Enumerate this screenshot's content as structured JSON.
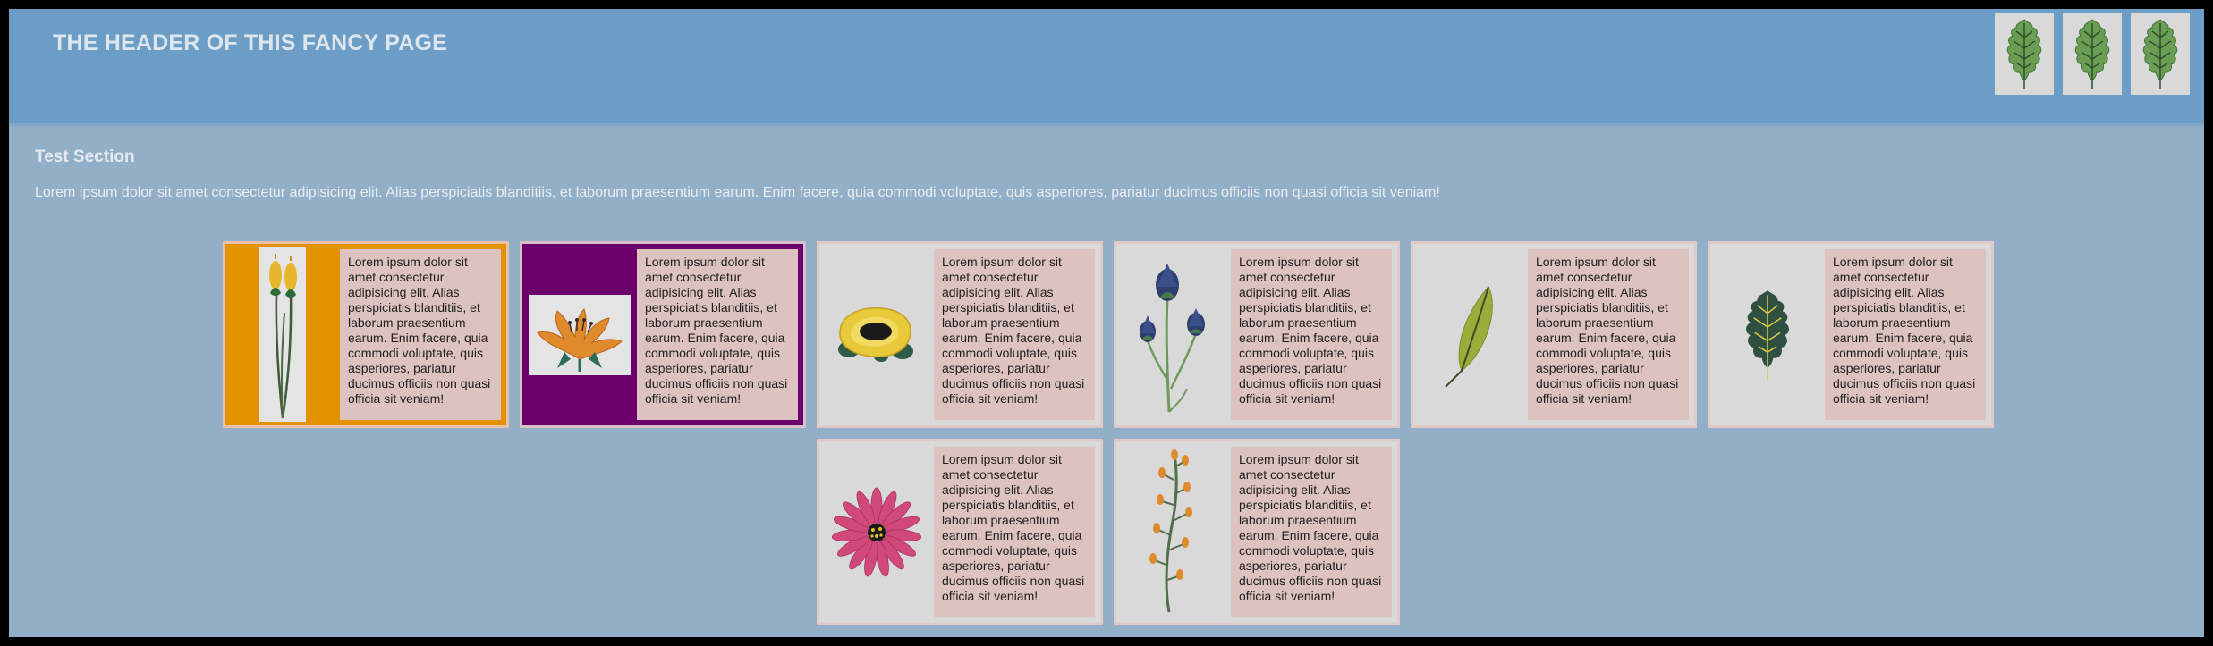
{
  "header": {
    "title": "THE HEADER OF THIS FANCY PAGE",
    "icons": [
      "oak-leaf-icon",
      "oak-leaf-icon",
      "oak-leaf-icon"
    ]
  },
  "section": {
    "title": "Test Section",
    "intro": "Lorem ipsum dolor sit amet consectetur adipisicing elit. Alias perspiciatis blanditiis, et laborum praesentium earum. Enim facere, quia commodi voluptate, quis asperiores, pariatur ducimus officiis non quasi officia sit veniam!"
  },
  "cards": [
    {
      "image": "yellow-tulip-buds-illustration",
      "text": "Lorem ipsum dolor sit amet consectetur adipisicing elit. Alias perspiciatis blanditiis, et laborum praesentium earum. Enim facere, quia commodi voluptate, quis asperiores, pariatur ducimus officiis non quasi officia sit veniam!",
      "background": "#e39300"
    },
    {
      "image": "orange-flower-illustration",
      "text": "Lorem ipsum dolor sit amet consectetur adipisicing elit. Alias perspiciatis blanditiis, et laborum praesentium earum. Enim facere, quia commodi voluptate, quis asperiores, pariatur ducimus officiis non quasi officia sit veniam!",
      "background": "#6b006b"
    },
    {
      "image": "yellow-rose-illustration",
      "text": "Lorem ipsum dolor sit amet consectetur adipisicing elit. Alias perspiciatis blanditiis, et laborum praesentium earum. Enim facere, quia commodi voluptate, quis asperiores, pariatur ducimus officiis non quasi officia sit veniam!",
      "background": "#d9d9d9"
    },
    {
      "image": "blue-thistle-illustration",
      "text": "Lorem ipsum dolor sit amet consectetur adipisicing elit. Alias perspiciatis blanditiis, et laborum praesentium earum. Enim facere, quia commodi voluptate, quis asperiores, pariatur ducimus officiis non quasi officia sit veniam!",
      "background": "#d9d9d9"
    },
    {
      "image": "olive-leaf-illustration",
      "text": "Lorem ipsum dolor sit amet consectetur adipisicing elit. Alias perspiciatis blanditiis, et laborum praesentium earum. Enim facere, quia commodi voluptate, quis asperiores, pariatur ducimus officiis non quasi officia sit veniam!",
      "background": "#d9d9d9"
    },
    {
      "image": "oak-leaf-illustration",
      "text": "Lorem ipsum dolor sit amet consectetur adipisicing elit. Alias perspiciatis blanditiis, et laborum praesentium earum. Enim facere, quia commodi voluptate, quis asperiores, pariatur ducimus officiis non quasi officia sit veniam!",
      "background": "#d9d9d9"
    },
    {
      "image": "pink-daisy-illustration",
      "text": "Lorem ipsum dolor sit amet consectetur adipisicing elit. Alias perspiciatis blanditiis, et laborum praesentium earum. Enim facere, quia commodi voluptate, quis asperiores, pariatur ducimus officiis non quasi officia sit veniam!",
      "background": "#d9d9d9"
    },
    {
      "image": "orange-berry-sprig-illustration",
      "text": "Lorem ipsum dolor sit amet consectetur adipisicing elit. Alias perspiciatis blanditiis, et laborum praesentium earum. Enim facere, quia commodi voluptate, quis asperiores, pariatur ducimus officiis non quasi officia sit veniam!",
      "background": "#d9d9d9"
    }
  ]
}
